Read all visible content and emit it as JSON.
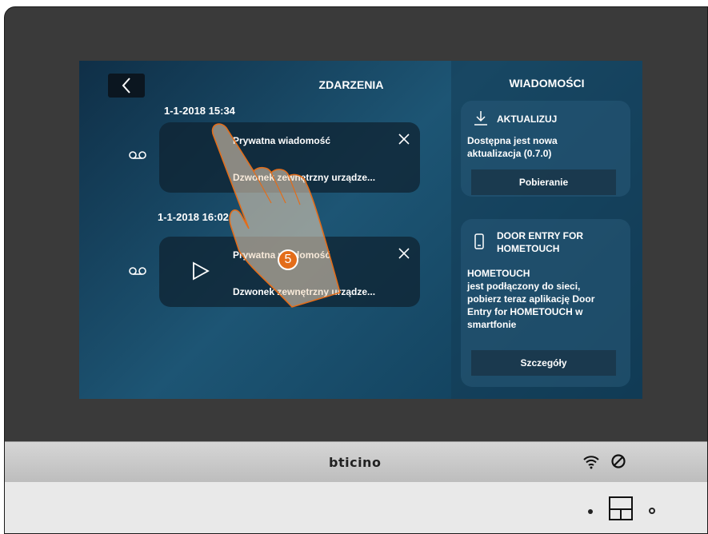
{
  "events": {
    "title": "ZDARZENIA",
    "items": [
      {
        "timestamp": "1-1-2018 15:34",
        "sender": "Prywatna wiadomość",
        "description": "Dzwonek zewnętrzny urządze..."
      },
      {
        "timestamp": "1-1-2018 16:02",
        "sender": "Prywatna wiadomość",
        "description": "Dzwonek zewnętrzny urządze..."
      }
    ]
  },
  "messages": {
    "title": "WIADOMOŚCI",
    "update": {
      "title": "AKTUALIZUJ",
      "text": "Dostępna jest nowa aktualizacja (0.7.0)",
      "button": "Pobieranie"
    },
    "app": {
      "title_line1": "DOOR ENTRY FOR",
      "title_line2": "HOMETOUCH",
      "text_line1": "HOMETOUCH",
      "text_line2": "jest podłączony do sieci,",
      "text_line3": "pobierz teraz aplikację Door",
      "text_line4": "Entry for HOMETOUCH w",
      "text_line5": "smartfonie",
      "button": "Szczegóły"
    }
  },
  "step_number": "5",
  "brand": "bticino",
  "icons": [
    "back-arrow-icon",
    "voicemail-icon",
    "close-icon",
    "play-icon",
    "download-icon",
    "smartphone-icon",
    "wifi-icon",
    "mute-icon",
    "home-button-icon"
  ],
  "colors": {
    "accent": "#e36d1a",
    "screen": "#1d5574"
  }
}
